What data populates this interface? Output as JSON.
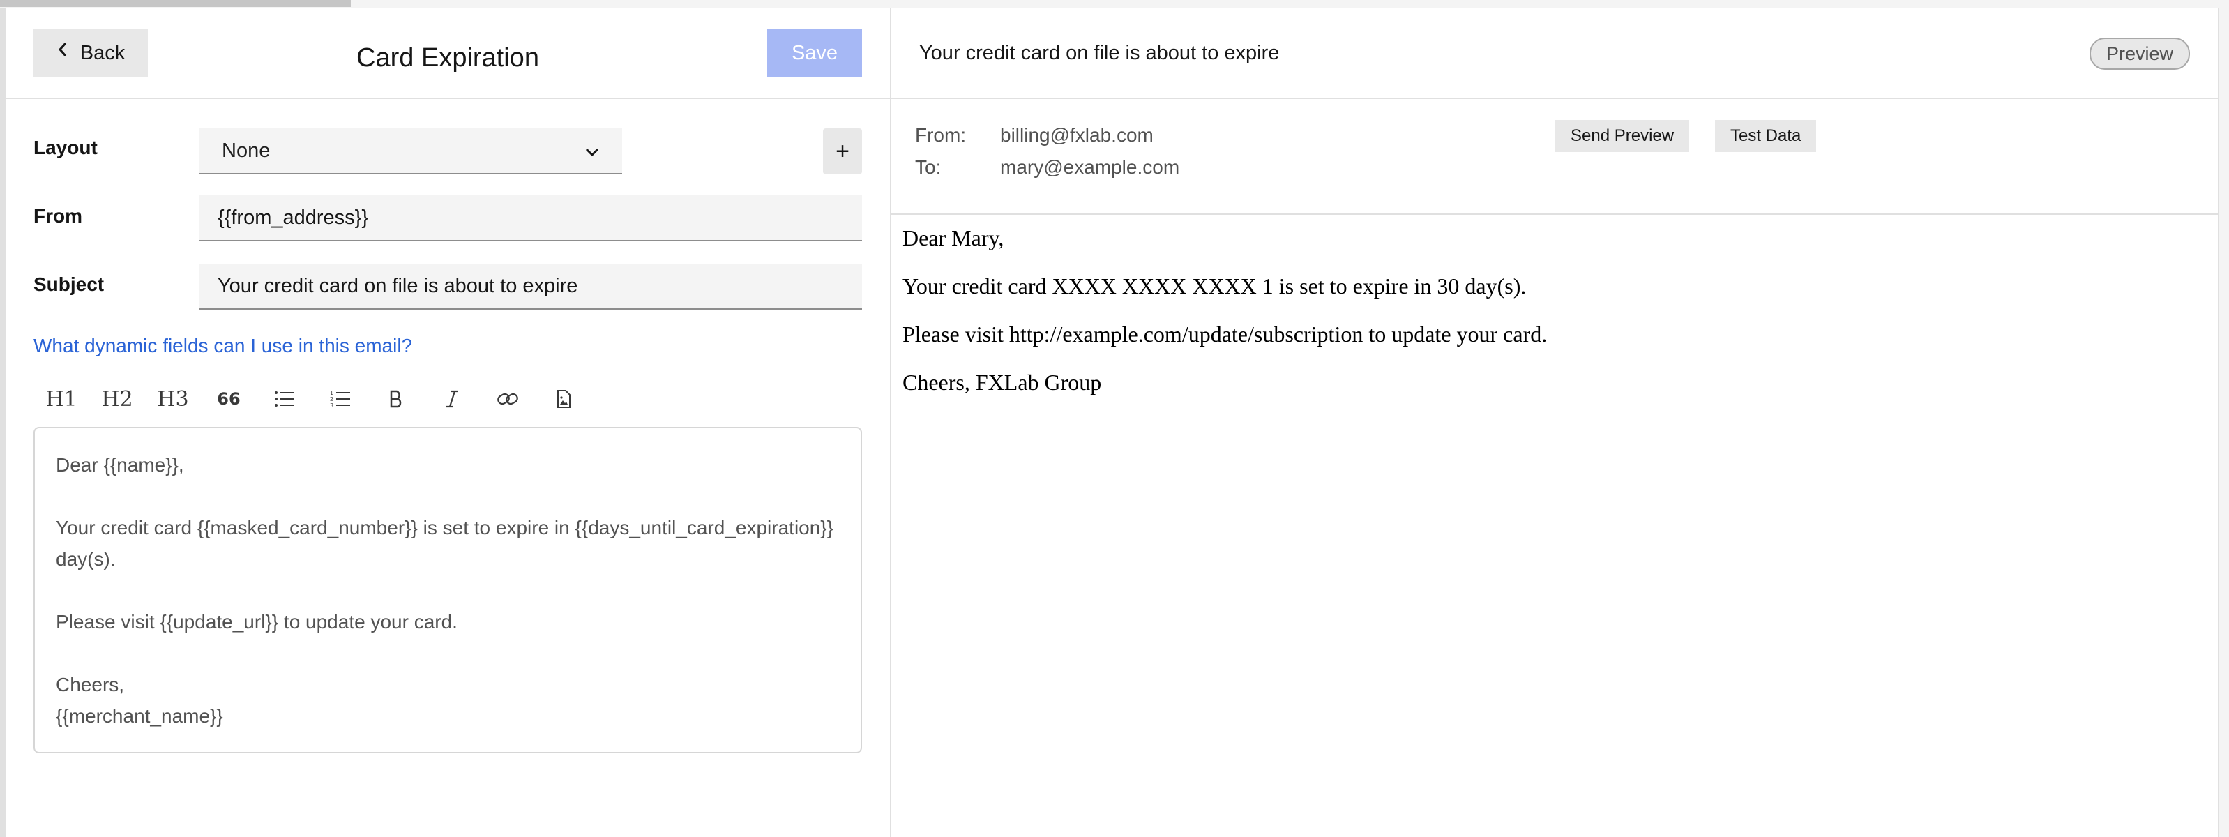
{
  "editor": {
    "back_label": "Back",
    "title": "Card Expiration",
    "save_label": "Save",
    "layout_label": "Layout",
    "layout_value": "None",
    "add_label": "+",
    "from_label": "From",
    "from_value": "{{from_address}}",
    "subject_label": "Subject",
    "subject_value": "Your credit card on file is about to expire",
    "help_link": "What dynamic fields can I use in this email?",
    "toolbar": {
      "h1": "H1",
      "h2": "H2",
      "h3": "H3",
      "quote": "66"
    },
    "body": "Dear {{name}},\n\nYour credit card {{masked_card_number}} is set to expire in {{days_until_card_expiration}} day(s).\n\nPlease visit {{update_url}} to update your card.\n\nCheers,\n{{merchant_name}}"
  },
  "preview": {
    "subject": "Your credit card on file is about to expire",
    "pill_label": "Preview",
    "from_label": "From:",
    "from_value": "billing@fxlab.com",
    "to_label": "To:",
    "to_value": "mary@example.com",
    "send_preview_label": "Send Preview",
    "test_data_label": "Test Data",
    "body": [
      "Dear Mary,",
      "Your credit card XXXX XXXX XXXX 1 is set to expire in 30 day(s).",
      "Please visit http://example.com/update/subscription to update your card.",
      "Cheers, FXLab Group"
    ]
  },
  "colors": {
    "accent_link": "#2a63d6",
    "save_disabled": "#a6b8f5"
  },
  "icons": {
    "back": "chevron-left-icon",
    "layout_dropdown": "chevron-down-icon",
    "bulleted_list": "bulleted-list-icon",
    "numbered_list": "numbered-list-icon",
    "bold": "bold-icon",
    "italic": "italic-icon",
    "link": "link-icon",
    "image": "image-file-icon"
  }
}
